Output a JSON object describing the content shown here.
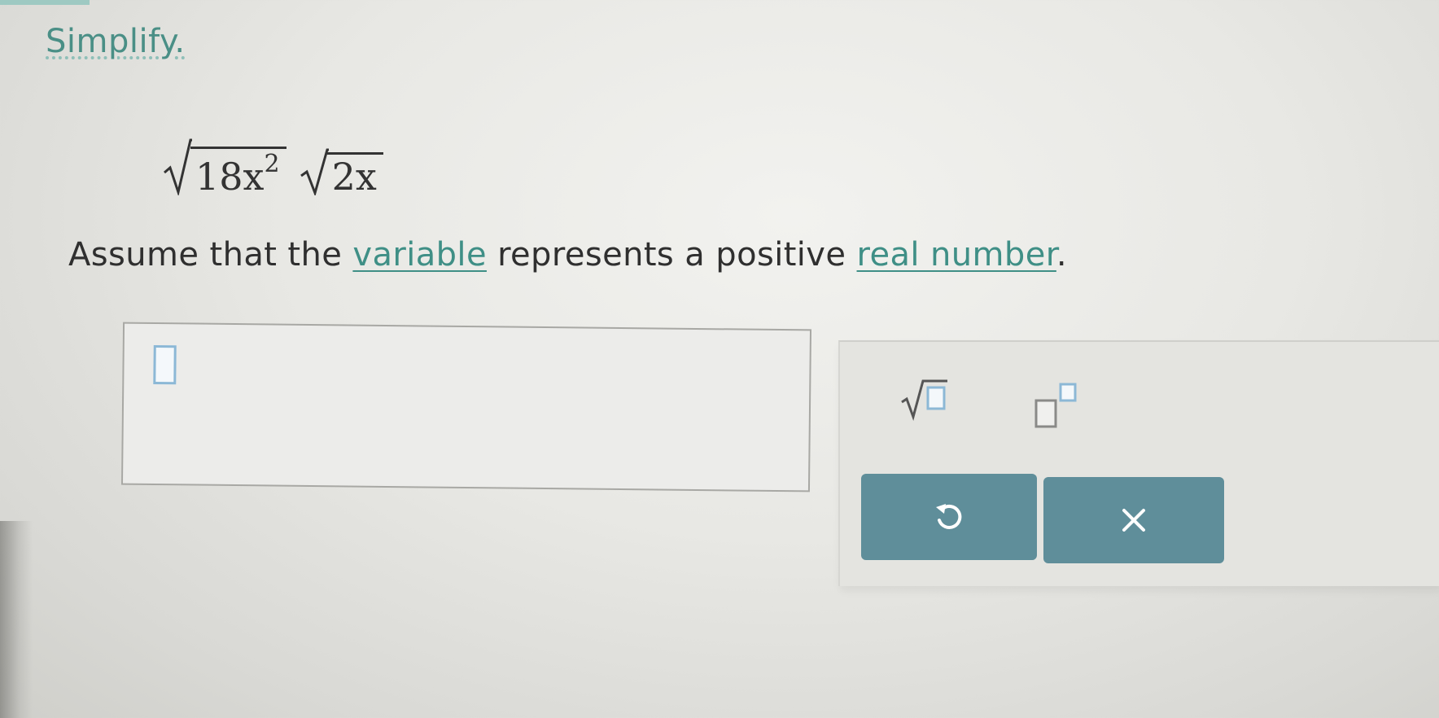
{
  "instruction": "Simplify.",
  "expression": {
    "radicand1_base": "18x",
    "radicand1_exp": "2",
    "radicand2": "2x"
  },
  "assumption": {
    "before": "Assume that the ",
    "link1": "variable",
    "middle": " represents a positive ",
    "link2": "real number",
    "after": "."
  },
  "answer_box": {
    "value": ""
  },
  "palette": {
    "tools": [
      {
        "name": "square-root",
        "icon": "sqrt-icon"
      },
      {
        "name": "exponent",
        "icon": "superscript-icon"
      }
    ],
    "actions": [
      {
        "name": "undo",
        "icon": "undo-icon"
      },
      {
        "name": "clear",
        "icon": "close-icon"
      }
    ]
  },
  "colors": {
    "link": "#3f8f86",
    "instruction": "#4a8f86",
    "button": "#5f8e9a",
    "placeholder_border": "#8cb8d6"
  }
}
